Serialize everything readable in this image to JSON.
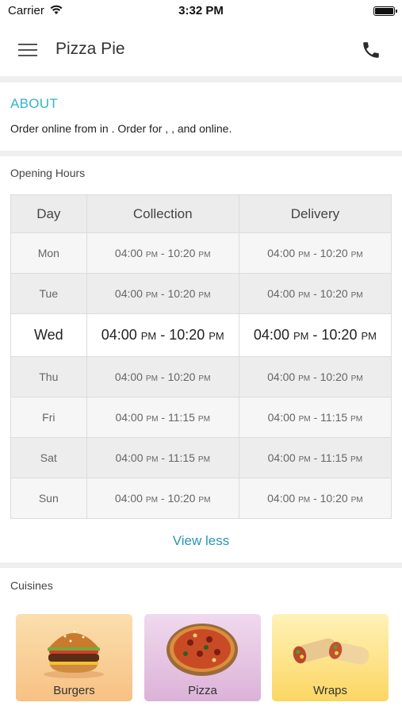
{
  "status_bar": {
    "carrier": "Carrier",
    "time": "3:32 PM"
  },
  "header": {
    "title": "Pizza Pie",
    "menu_icon": "hamburger-menu-icon",
    "phone_icon": "phone-icon"
  },
  "about": {
    "title": "ABOUT",
    "text": "Order online from  in . Order for , ,  and  online."
  },
  "opening_hours": {
    "title": "Opening Hours",
    "columns": [
      "Day",
      "Collection",
      "Delivery"
    ],
    "rows": [
      {
        "day": "Mon",
        "col_start": "04:00",
        "col_start_ap": "PM",
        "col_end": "10:20",
        "col_end_ap": "PM",
        "del_start": "04:00",
        "del_start_ap": "PM",
        "del_end": "10:20",
        "del_end_ap": "PM"
      },
      {
        "day": "Tue",
        "col_start": "04:00",
        "col_start_ap": "PM",
        "col_end": "10:20",
        "col_end_ap": "PM",
        "del_start": "04:00",
        "del_start_ap": "PM",
        "del_end": "10:20",
        "del_end_ap": "PM"
      },
      {
        "day": "Wed",
        "col_start": "04:00",
        "col_start_ap": "PM",
        "col_end": "10:20",
        "col_end_ap": "PM",
        "del_start": "04:00",
        "del_start_ap": "PM",
        "del_end": "10:20",
        "del_end_ap": "PM"
      },
      {
        "day": "Thu",
        "col_start": "04:00",
        "col_start_ap": "PM",
        "col_end": "10:20",
        "col_end_ap": "PM",
        "del_start": "04:00",
        "del_start_ap": "PM",
        "del_end": "10:20",
        "del_end_ap": "PM"
      },
      {
        "day": "Fri",
        "col_start": "04:00",
        "col_start_ap": "PM",
        "col_end": "11:15",
        "col_end_ap": "PM",
        "del_start": "04:00",
        "del_start_ap": "PM",
        "del_end": "11:15",
        "del_end_ap": "PM"
      },
      {
        "day": "Sat",
        "col_start": "04:00",
        "col_start_ap": "PM",
        "col_end": "11:15",
        "col_end_ap": "PM",
        "del_start": "04:00",
        "del_start_ap": "PM",
        "del_end": "11:15",
        "del_end_ap": "PM"
      },
      {
        "day": "Sun",
        "col_start": "04:00",
        "col_start_ap": "PM",
        "col_end": "10:20",
        "col_end_ap": "PM",
        "del_start": "04:00",
        "del_start_ap": "PM",
        "del_end": "10:20",
        "del_end_ap": "PM"
      }
    ],
    "today": "Wed",
    "toggle_label": "View less"
  },
  "cuisines": {
    "title": "Cuisines",
    "items": [
      {
        "label": "Burgers",
        "icon": "burger-icon"
      },
      {
        "label": "Pizza",
        "icon": "pizza-icon"
      },
      {
        "label": "Wraps",
        "icon": "wrap-icon"
      }
    ]
  },
  "colors": {
    "accent": "#33b5c5",
    "link": "#2b95b8",
    "header_bg": "#ffffff",
    "page_bg": "#efefef"
  }
}
